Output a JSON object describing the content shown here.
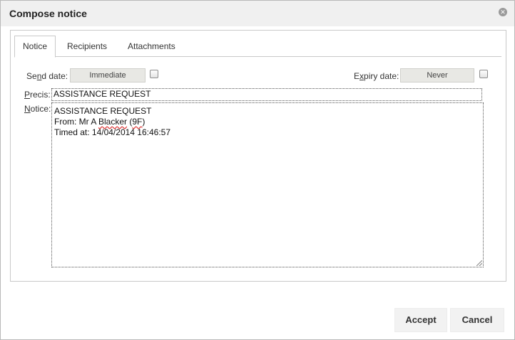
{
  "window": {
    "title": "Compose notice",
    "close_glyph": "✕"
  },
  "tabs": [
    {
      "label": "Notice",
      "active": true
    },
    {
      "label": "Recipients",
      "active": false
    },
    {
      "label": "Attachments",
      "active": false
    }
  ],
  "send_date": {
    "label_pre": "Se",
    "label_u": "n",
    "label_post": "d date:",
    "value": "Immediate",
    "checked": false
  },
  "expiry_date": {
    "label_pre": "E",
    "label_u": "x",
    "label_post": "piry date:",
    "value": "Never",
    "checked": false
  },
  "precis": {
    "label_u": "P",
    "label_post": "recis:",
    "value": "ASSISTANCE REQUEST"
  },
  "notice": {
    "label_u": "N",
    "label_post": "otice:",
    "line1": "ASSISTANCE REQUEST",
    "line2_pre": "From: Mr A ",
    "line2_spell": "Blacker",
    "line2_mid": " (",
    "line2_spell2": "9F",
    "line2_post": ")",
    "line3": "Timed at: 14/04/2014 16:46:57"
  },
  "footer": {
    "accept_label": "Accept",
    "cancel_label": "Cancel"
  },
  "icons": {
    "close": "close-icon",
    "resize": "resize-grip-icon"
  }
}
